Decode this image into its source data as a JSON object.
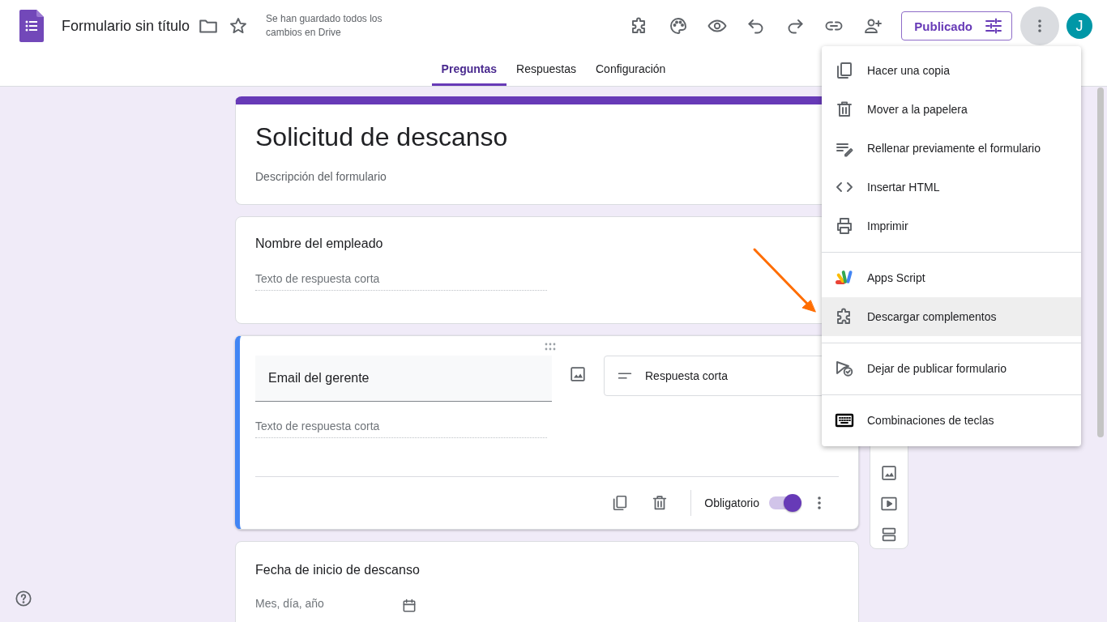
{
  "app": {
    "title": "Formulario sin título",
    "save_status": "Se han guardado todos los cambios en Drive",
    "publish_button": "Publicado",
    "avatar": "J"
  },
  "tabs": [
    {
      "label": "Preguntas",
      "selected": true
    },
    {
      "label": "Respuestas",
      "selected": false
    },
    {
      "label": "Configuración",
      "selected": false
    }
  ],
  "form": {
    "title": "Solicitud de descanso",
    "description": "Descripción del formulario"
  },
  "questions": [
    {
      "kind": "short",
      "title": "Nombre del empleado",
      "placeholder": "Texto de respuesta corta"
    },
    {
      "kind": "editing",
      "title": "Email del gerente",
      "placeholder": "Texto de respuesta corta",
      "type": "Respuesta corta",
      "required_label": "Obligatorio",
      "required": true
    },
    {
      "kind": "date",
      "title": "Fecha de inicio de descanso",
      "placeholder": "Mes, día, año"
    }
  ],
  "menu": {
    "sections": [
      [
        {
          "label": "Hacer una copia",
          "selected": false
        },
        {
          "label": "Mover a la papelera",
          "selected": false
        },
        {
          "label": "Rellenar previamente el formulario",
          "selected": false
        },
        {
          "label": "Insertar HTML",
          "selected": false
        },
        {
          "label": "Imprimir",
          "selected": false
        }
      ],
      [
        {
          "label": "Apps Script",
          "selected": false
        },
        {
          "label": "Descargar complementos",
          "selected": true
        }
      ],
      [
        {
          "label": "Dejar de publicar formulario",
          "selected": false
        }
      ],
      [
        {
          "label": "Combinaciones de teclas",
          "selected": false
        }
      ]
    ]
  }
}
